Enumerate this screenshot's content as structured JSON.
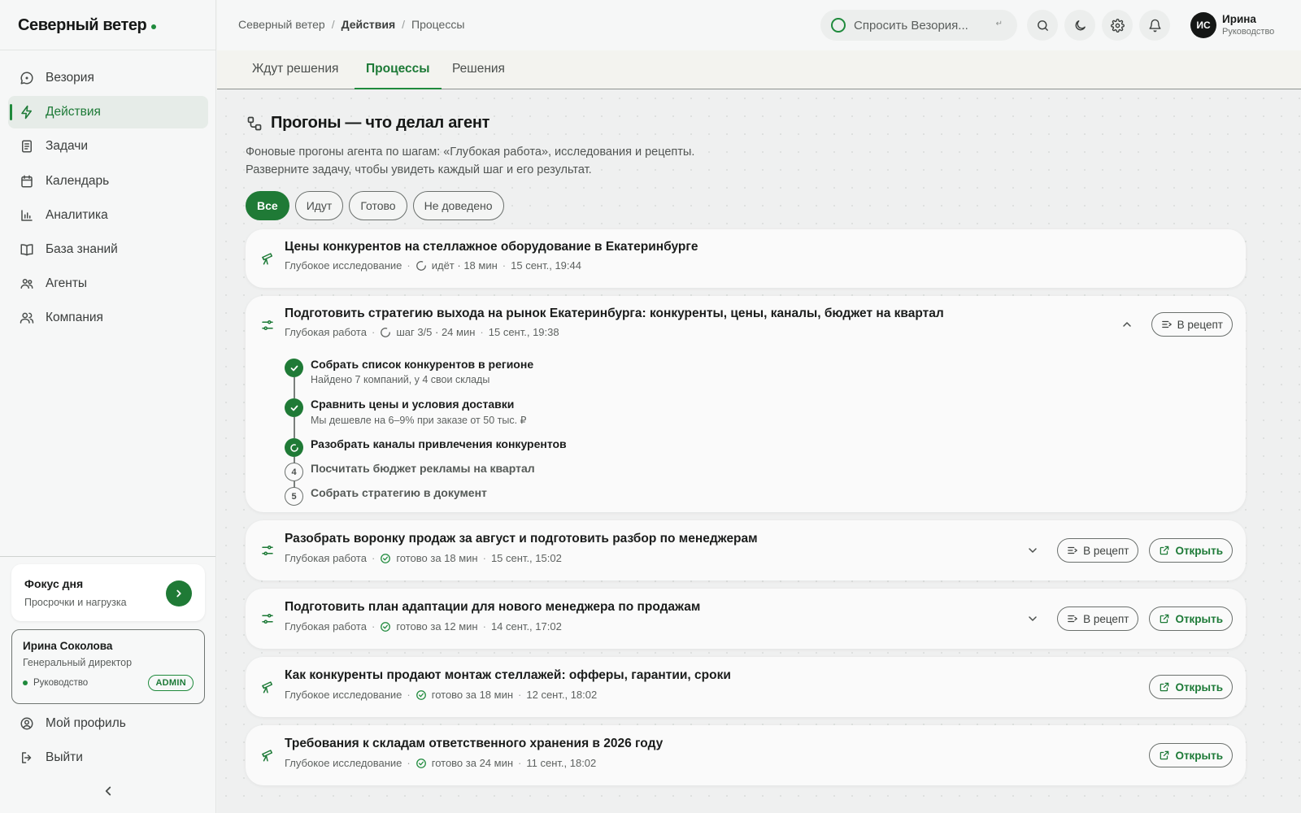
{
  "brand": {
    "name": "Северный ветер",
    "accent": "#1f8a3c"
  },
  "sidebar": {
    "items": [
      {
        "label": "Везория",
        "icon": "chat-bubble-icon"
      },
      {
        "label": "Действия",
        "icon": "bolt-icon",
        "active": true
      },
      {
        "label": "Задачи",
        "icon": "task-list-icon"
      },
      {
        "label": "Календарь",
        "icon": "calendar-icon"
      },
      {
        "label": "Аналитика",
        "icon": "bar-chart-icon"
      },
      {
        "label": "База знаний",
        "icon": "book-icon"
      },
      {
        "label": "Агенты",
        "icon": "agents-icon"
      },
      {
        "label": "Компания",
        "icon": "company-icon"
      }
    ],
    "focus": {
      "title": "Фокус дня",
      "subtitle": "Просрочки и нагрузка"
    },
    "user": {
      "name": "Ирина Соколова",
      "role": "Генеральный директор",
      "dept": "Руководство",
      "badge": "ADMIN"
    },
    "bottom": [
      {
        "label": "Мой профиль",
        "icon": "profile-icon"
      },
      {
        "label": "Выйти",
        "icon": "logout-icon"
      }
    ]
  },
  "header": {
    "breadcrumb": [
      "Северный ветер",
      "Действия",
      "Процессы"
    ],
    "ask_placeholder": "Спросить Везория...",
    "ask_hint": "↵",
    "user": {
      "initials": "ИС",
      "name": "Ирина",
      "role": "Руководство"
    }
  },
  "tabs": [
    "Ждут решения",
    "Процессы",
    "Решения"
  ],
  "page": {
    "title": "Прогоны — что делал агент",
    "desc_line1": "Фоновые прогоны агента по шагам: «Глубокая работа», исследования и рецепты.",
    "desc_line2": "Разверните задачу, чтобы увидеть каждый шаг и его результат.",
    "filters": [
      "Все",
      "Идут",
      "Готово",
      "Не доведено"
    ],
    "active_filter": "Все"
  },
  "buttons": {
    "to_recipe": "В рецепт",
    "open": "Открыть"
  },
  "runs": [
    {
      "title": "Цены конкурентов на стеллажное оборудование в Екатеринбурге",
      "type": "Глубокое исследование",
      "status": "идёт · 18 мин",
      "state": "running",
      "date": "15 сент., 19:44",
      "icon": "telescope-icon"
    },
    {
      "title": "Подготовить стратегию выхода на рынок Екатеринбурга: конкуренты, цены, каналы, бюджет на квартал",
      "type": "Глубокая работа",
      "status": "шаг 3/5 · 24 мин",
      "state": "running",
      "date": "15 сент., 19:38",
      "icon": "sliders-icon",
      "expanded": true,
      "steps": [
        {
          "title": "Собрать список конкурентов в регионе",
          "sub": "Найдено 7 компаний, у 4 свои склады",
          "state": "done"
        },
        {
          "title": "Сравнить цены и условия доставки",
          "sub": "Мы дешевле на 6–9% при заказе от 50 тыс. ₽",
          "state": "done"
        },
        {
          "title": "Разобрать каналы привлечения конкурентов",
          "sub": "",
          "state": "running"
        },
        {
          "title": "Посчитать бюджет рекламы на квартал",
          "sub": "",
          "state": "todo",
          "num": "4"
        },
        {
          "title": "Собрать стратегию в документ",
          "sub": "",
          "state": "todo",
          "num": "5"
        }
      ]
    },
    {
      "title": "Разобрать воронку продаж за август и подготовить разбор по менеджерам",
      "type": "Глубокая работа",
      "status": "готово за 18 мин",
      "state": "done",
      "date": "15 сент., 15:02",
      "icon": "sliders-icon"
    },
    {
      "title": "Подготовить план адаптации для нового менеджера по продажам",
      "type": "Глубокая работа",
      "status": "готово за 12 мин",
      "state": "done",
      "date": "14 сент., 17:02",
      "icon": "sliders-icon"
    },
    {
      "title": "Как конкуренты продают монтаж стеллажей: офферы, гарантии, сроки",
      "type": "Глубокое исследование",
      "status": "готово за 18 мин",
      "state": "done",
      "date": "12 сент., 18:02",
      "icon": "telescope-icon"
    },
    {
      "title": "Требования к складам ответственного хранения в 2026 году",
      "type": "Глубокое исследование",
      "status": "готово за 24 мин",
      "state": "done",
      "date": "11 сент., 18:02",
      "icon": "telescope-icon"
    }
  ]
}
